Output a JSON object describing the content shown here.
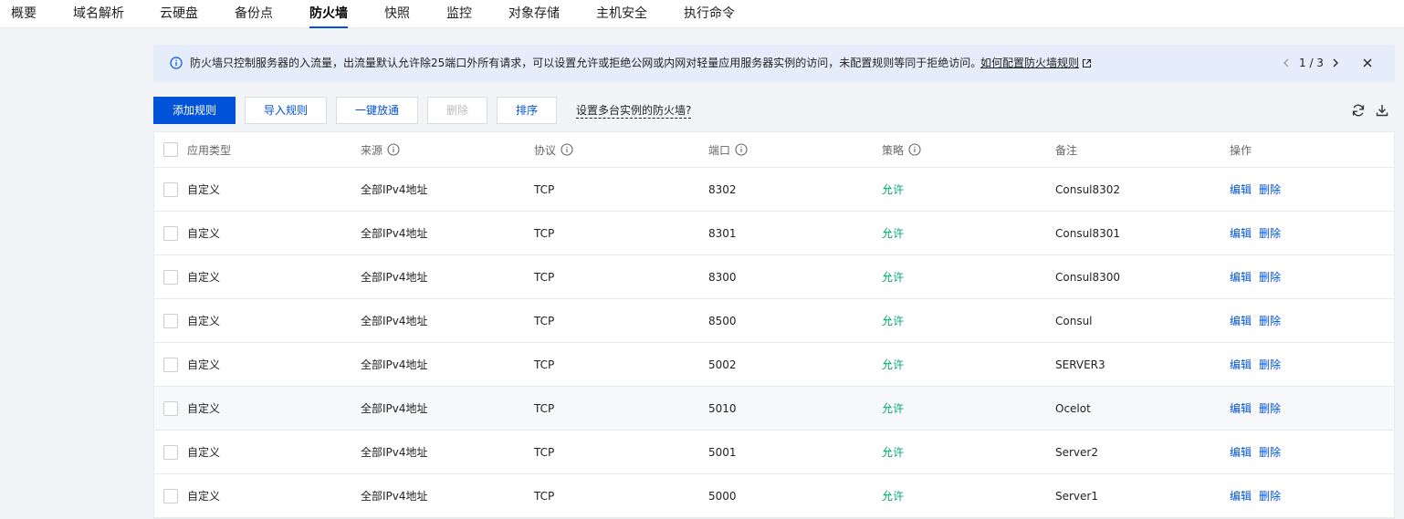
{
  "tabs": [
    "概要",
    "域名解析",
    "云硬盘",
    "备份点",
    "防火墙",
    "快照",
    "监控",
    "对象存储",
    "主机安全",
    "执行命令"
  ],
  "active_tab": "防火墙",
  "notice": {
    "text": "防火墙只控制服务器的入流量，出流量默认允许除25端口外所有请求，可以设置允许或拒绝公网或内网对轻量应用服务器实例的访问，未配置规则等同于拒绝访问。",
    "link": "如何配置防火墙规则",
    "page": "1 / 3"
  },
  "toolbar": {
    "add": "添加规则",
    "import": "导入规则",
    "open_all": "一键放通",
    "delete": "删除",
    "sort": "排序",
    "multi": "设置多台实例的防火墙?"
  },
  "columns": [
    "应用类型",
    "来源",
    "协议",
    "端口",
    "策略",
    "备注",
    "操作"
  ],
  "rows": [
    {
      "type": "自定义",
      "source": "全部IPv4地址",
      "protocol": "TCP",
      "port": "8302",
      "policy": "允许",
      "remark": "Consul8302"
    },
    {
      "type": "自定义",
      "source": "全部IPv4地址",
      "protocol": "TCP",
      "port": "8301",
      "policy": "允许",
      "remark": "Consul8301"
    },
    {
      "type": "自定义",
      "source": "全部IPv4地址",
      "protocol": "TCP",
      "port": "8300",
      "policy": "允许",
      "remark": "Consul8300"
    },
    {
      "type": "自定义",
      "source": "全部IPv4地址",
      "protocol": "TCP",
      "port": "8500",
      "policy": "允许",
      "remark": "Consul"
    },
    {
      "type": "自定义",
      "source": "全部IPv4地址",
      "protocol": "TCP",
      "port": "5002",
      "policy": "允许",
      "remark": "SERVER3"
    },
    {
      "type": "自定义",
      "source": "全部IPv4地址",
      "protocol": "TCP",
      "port": "5010",
      "policy": "允许",
      "remark": "Ocelot"
    },
    {
      "type": "自定义",
      "source": "全部IPv4地址",
      "protocol": "TCP",
      "port": "5001",
      "policy": "允许",
      "remark": "Server2"
    },
    {
      "type": "自定义",
      "source": "全部IPv4地址",
      "protocol": "TCP",
      "port": "5000",
      "policy": "允许",
      "remark": "Server1"
    }
  ],
  "actions": {
    "edit": "编辑",
    "delete": "删除"
  },
  "colors": {
    "primary": "#0052d9",
    "allow": "#00a870",
    "notice_bg": "#e5edfb"
  }
}
